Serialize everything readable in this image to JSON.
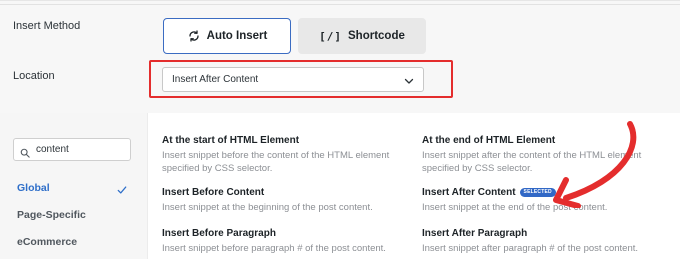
{
  "insert_method": {
    "label": "Insert Method",
    "auto_insert_label": "Auto Insert",
    "shortcode_label": "Shortcode",
    "shortcode_glyph": "[/]",
    "selected": "Auto Insert"
  },
  "location": {
    "label": "Location",
    "selected_value": "Insert After Content"
  },
  "search": {
    "value": "content"
  },
  "sidebar": {
    "items": [
      {
        "label": "Global",
        "selected": true
      },
      {
        "label": "Page-Specific",
        "selected": false
      },
      {
        "label": "eCommerce",
        "selected": false
      }
    ]
  },
  "options": [
    {
      "title": "At the start of HTML Element",
      "description": "Insert snippet before the content of the HTML element specified by CSS selector."
    },
    {
      "title": "At the end of HTML Element",
      "description": "Insert snippet after the content of the HTML element specified by CSS selector."
    },
    {
      "title": "Insert Before Content",
      "description": "Insert snippet at the beginning of the post content."
    },
    {
      "title": "Insert After Content",
      "description": "Insert snippet at the end of the post content.",
      "badge": "SELECTED"
    },
    {
      "title": "Insert Before Paragraph",
      "description": "Insert snippet before paragraph # of the post content."
    },
    {
      "title": "Insert After Paragraph",
      "description": "Insert snippet after paragraph # of the post content."
    }
  ],
  "colors": {
    "accent": "#3168c6",
    "highlight": "#e42d2d"
  },
  "icons": {
    "auto_insert": "refresh-icon",
    "location_select": "chevron-down-icon",
    "search": "search-icon",
    "selected_category": "checkmark-icon",
    "annotation": "red-arrow-annotation"
  }
}
